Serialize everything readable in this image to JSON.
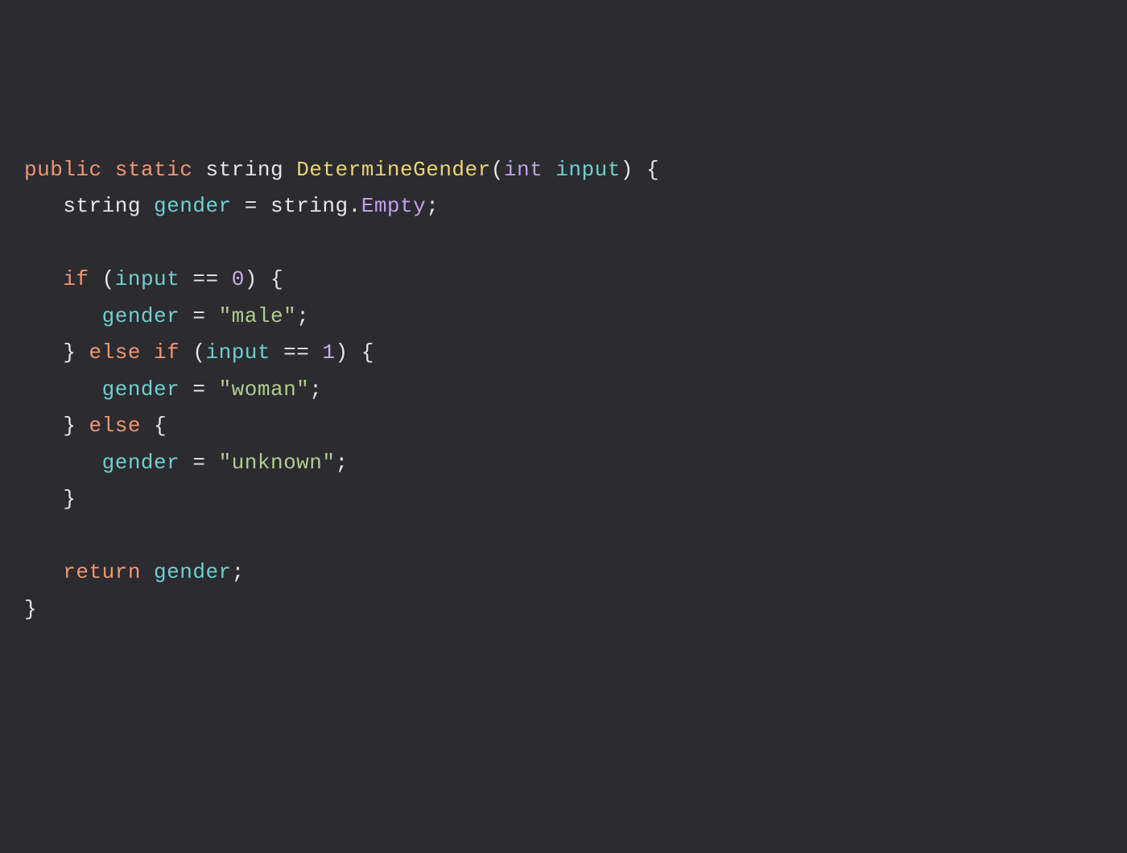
{
  "code": {
    "line1": {
      "kw_public": "public",
      "kw_static": "static",
      "type_string": "string",
      "func_name": "DetermineGender",
      "paren_open": "(",
      "param_type": "int",
      "param_name": "input",
      "paren_close": ")",
      "brace_open": " {"
    },
    "line2": {
      "indent": "   ",
      "type_string": "string",
      "var_name": "gender",
      "eq": " = ",
      "string_obj": "string",
      "dot": ".",
      "prop_empty": "Empty",
      "semi": ";"
    },
    "line4": {
      "indent": "   ",
      "kw_if": "if",
      "paren_open": " (",
      "var_input": "input",
      "eq_op": " == ",
      "num0": "0",
      "paren_close": ")",
      "brace_open": " {"
    },
    "line5": {
      "indent": "      ",
      "var_gender": "gender",
      "eq": " = ",
      "str_male": "\"male\"",
      "semi": ";"
    },
    "line6": {
      "indent": "   ",
      "brace_close": "}",
      "kw_else": " else ",
      "kw_if": "if",
      "paren_open": " (",
      "var_input": "input",
      "eq_op": " == ",
      "num1": "1",
      "paren_close": ")",
      "brace_open": " {"
    },
    "line7": {
      "indent": "      ",
      "var_gender": "gender",
      "eq": " = ",
      "str_woman": "\"woman\"",
      "semi": ";"
    },
    "line8": {
      "indent": "   ",
      "brace_close": "}",
      "kw_else": " else ",
      "brace_open": "{"
    },
    "line9": {
      "indent": "      ",
      "var_gender": "gender",
      "eq": " = ",
      "str_unknown": "\"unknown\"",
      "semi": ";"
    },
    "line10": {
      "indent": "   ",
      "brace_close": "}"
    },
    "line12": {
      "indent": "   ",
      "kw_return": "return",
      "sp": " ",
      "var_gender": "gender",
      "semi": ";"
    },
    "line13": {
      "brace_close": "}"
    }
  }
}
